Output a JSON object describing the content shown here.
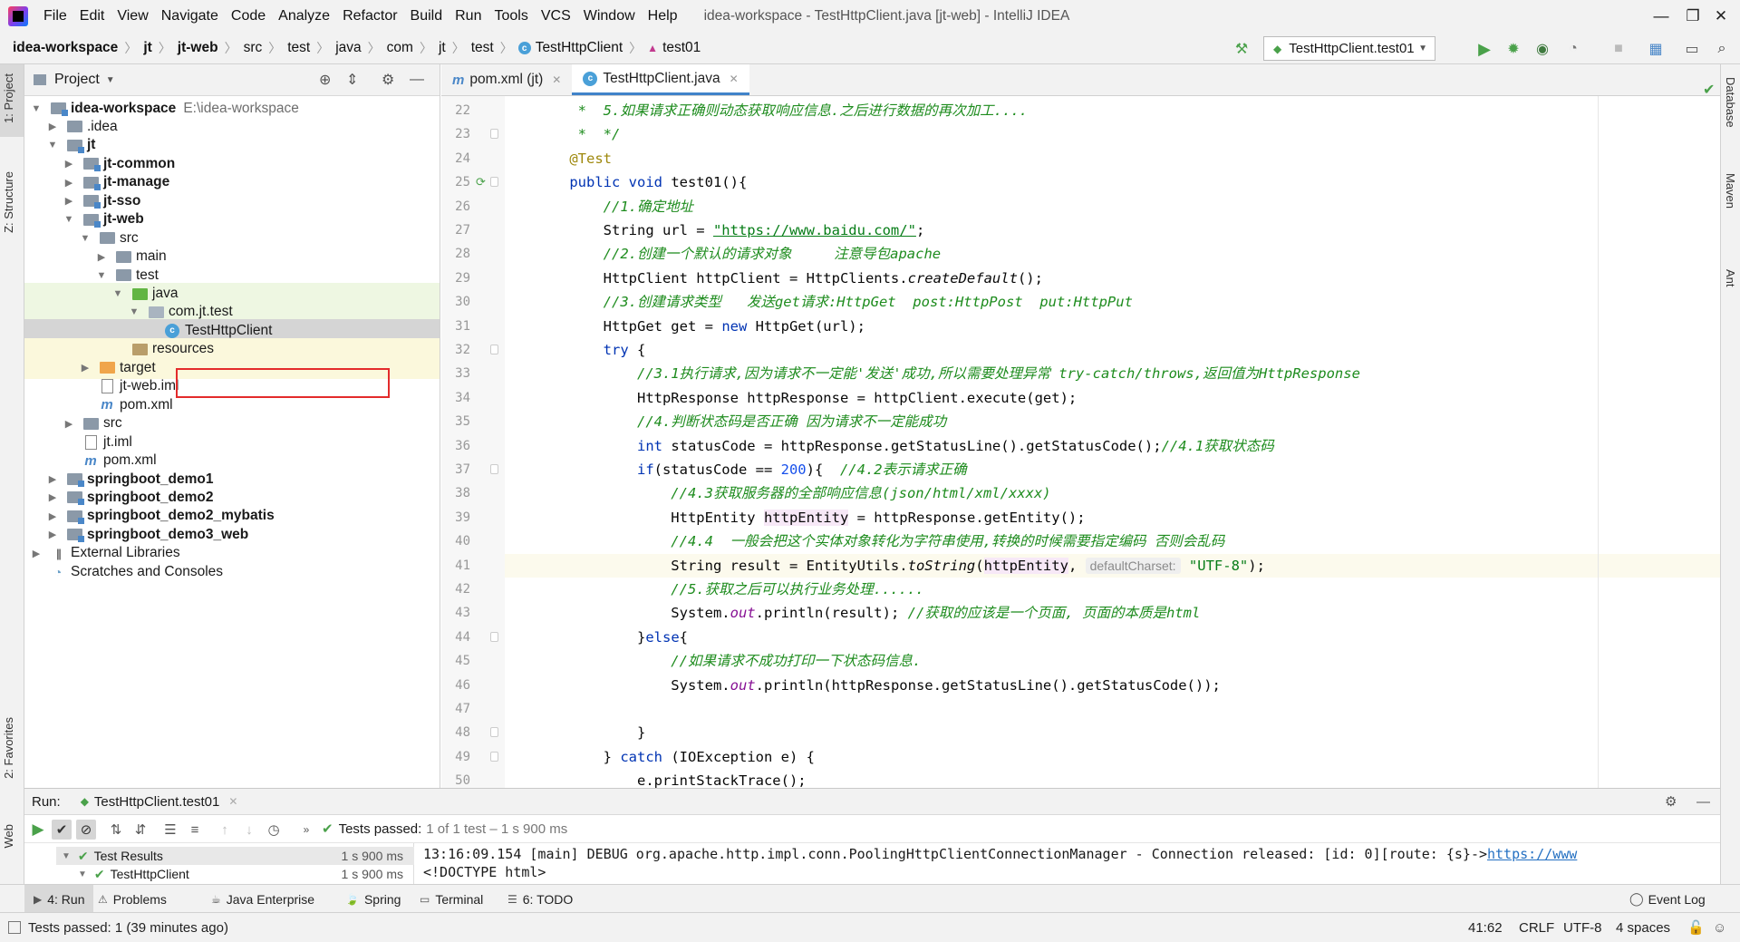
{
  "menubar": {
    "items": [
      "File",
      "Edit",
      "View",
      "Navigate",
      "Code",
      "Analyze",
      "Refactor",
      "Build",
      "Run",
      "Tools",
      "VCS",
      "Window",
      "Help"
    ],
    "window_title": "idea-workspace - TestHttpClient.java [jt-web] - IntelliJ IDEA",
    "controls": [
      "—",
      "❐",
      "✕"
    ]
  },
  "breadcrumbs": [
    "idea-workspace",
    "jt",
    "jt-web",
    "src",
    "test",
    "java",
    "com",
    "jt",
    "test",
    "TestHttpClient",
    "test01"
  ],
  "run_config": "TestHttpClient.test01",
  "left_stripe": {
    "project": "1: Project",
    "structure": "Z: Structure",
    "favorites": "2: Favorites",
    "web": "Web"
  },
  "right_stripe": {
    "database": "Database",
    "maven": "Maven",
    "ant": "Ant"
  },
  "project_panel": {
    "title": "Project",
    "tree": [
      {
        "label": "idea-workspace",
        "hint": "E:\\idea-workspace",
        "depth": 0,
        "arrow": "down",
        "icon": "module-folder",
        "bold": true
      },
      {
        "label": ".idea",
        "depth": 1,
        "arrow": "right",
        "icon": "folder"
      },
      {
        "label": "jt",
        "depth": 1,
        "arrow": "down",
        "icon": "module-folder",
        "bold": true
      },
      {
        "label": "jt-common",
        "depth": 2,
        "arrow": "right",
        "icon": "module-folder",
        "bold": true
      },
      {
        "label": "jt-manage",
        "depth": 2,
        "arrow": "right",
        "icon": "module-folder",
        "bold": true
      },
      {
        "label": "jt-sso",
        "depth": 2,
        "arrow": "right",
        "icon": "module-folder",
        "bold": true
      },
      {
        "label": "jt-web",
        "depth": 2,
        "arrow": "down",
        "icon": "module-folder",
        "bold": true
      },
      {
        "label": "src",
        "depth": 3,
        "arrow": "down",
        "icon": "folder"
      },
      {
        "label": "main",
        "depth": 4,
        "arrow": "right",
        "icon": "folder"
      },
      {
        "label": "test",
        "depth": 4,
        "arrow": "down",
        "icon": "folder"
      },
      {
        "label": "java",
        "depth": 5,
        "arrow": "down",
        "icon": "test-folder"
      },
      {
        "label": "com.jt.test",
        "depth": 6,
        "arrow": "down",
        "icon": "package"
      },
      {
        "label": "TestHttpClient",
        "depth": 7,
        "arrow": "",
        "icon": "class",
        "selected": true
      },
      {
        "label": "resources",
        "depth": 5,
        "arrow": "",
        "icon": "resources-folder"
      },
      {
        "label": "target",
        "depth": 3,
        "arrow": "right",
        "icon": "excluded-folder"
      },
      {
        "label": "jt-web.iml",
        "depth": 3,
        "arrow": "",
        "icon": "file"
      },
      {
        "label": "pom.xml",
        "depth": 3,
        "arrow": "",
        "icon": "maven"
      },
      {
        "label": "src",
        "depth": 2,
        "arrow": "right",
        "icon": "folder"
      },
      {
        "label": "jt.iml",
        "depth": 2,
        "arrow": "",
        "icon": "file"
      },
      {
        "label": "pom.xml",
        "depth": 2,
        "arrow": "",
        "icon": "maven"
      },
      {
        "label": "springboot_demo1",
        "depth": 1,
        "arrow": "right",
        "icon": "module-folder",
        "bold": true
      },
      {
        "label": "springboot_demo2",
        "depth": 1,
        "arrow": "right",
        "icon": "module-folder",
        "bold": true
      },
      {
        "label": "springboot_demo2_mybatis",
        "depth": 1,
        "arrow": "right",
        "icon": "module-folder",
        "bold": true
      },
      {
        "label": "springboot_demo3_web",
        "depth": 1,
        "arrow": "right",
        "icon": "module-folder",
        "bold": true
      },
      {
        "label": "External Libraries",
        "depth": 0,
        "arrow": "right",
        "icon": "libraries"
      },
      {
        "label": "Scratches and Consoles",
        "depth": 0,
        "arrow": "",
        "icon": "scratches"
      }
    ]
  },
  "editor": {
    "tabs": [
      {
        "label": "pom.xml (jt)",
        "icon": "m",
        "active": false
      },
      {
        "label": "TestHttpClient.java",
        "icon": "c",
        "active": true
      }
    ],
    "first_line": 22,
    "current_line": 41,
    "lines": [
      [
        [
          "cmg",
          "     *  5.如果请求正确则动态获取响应信息.之后进行数据的再次加工...."
        ]
      ],
      [
        [
          "cmg",
          "     *  */"
        ]
      ],
      [
        [
          "ann",
          "    @Test"
        ]
      ],
      [
        [
          "kw",
          "    public void "
        ],
        [
          "",
          "test01(){"
        ]
      ],
      [
        [
          "cmg",
          "        //1.确定地址"
        ]
      ],
      [
        [
          "",
          "        String url = "
        ],
        [
          "url",
          "\"https://www.baidu.com/\""
        ],
        [
          "",
          ";"
        ]
      ],
      [
        [
          "cmg",
          "        //2.创建一个默认的请求对象     注意导包apache"
        ]
      ],
      [
        [
          "",
          "        HttpClient httpClient = HttpClients."
        ],
        [
          "it",
          "createDefault"
        ],
        [
          "",
          "();"
        ]
      ],
      [
        [
          "cmg",
          "        //3.创建请求类型   发送get请求:HttpGet  post:HttpPost  put:HttpPut"
        ]
      ],
      [
        [
          "",
          "        HttpGet get = "
        ],
        [
          "kw",
          "new "
        ],
        [
          "",
          "HttpGet(url);"
        ]
      ],
      [
        [
          "kw",
          "        try "
        ],
        [
          "",
          "{"
        ]
      ],
      [
        [
          "cmg",
          "            //3.1执行请求,因为请求不一定能'发送'成功,所以需要处理异常 try-catch/throws,返回值为HttpResponse"
        ]
      ],
      [
        [
          "",
          "            HttpResponse httpResponse = httpClient.execute(get);"
        ]
      ],
      [
        [
          "cmg",
          "            //4.判断状态码是否正确 因为请求不一定能成功"
        ]
      ],
      [
        [
          "kw",
          "            int "
        ],
        [
          "",
          "statusCode = httpResponse.getStatusLine().getStatusCode();"
        ],
        [
          "cmg",
          "//4.1获取状态码"
        ]
      ],
      [
        [
          "kw",
          "            if"
        ],
        [
          "",
          "(statusCode == "
        ],
        [
          "num",
          "200"
        ],
        [
          "",
          "){  "
        ],
        [
          "cmg",
          "//4.2表示请求正确"
        ]
      ],
      [
        [
          "cmg",
          "                //4.3获取服务器的全部响应信息(json/html/xml/xxxx)"
        ]
      ],
      [
        [
          "",
          "                HttpEntity "
        ],
        [
          "hvar",
          "httpEntity"
        ],
        [
          "",
          " = httpResponse.getEntity();"
        ]
      ],
      [
        [
          "cmg",
          "                //4.4  一般会把这个实体对象转化为字符串使用,转换的时候需要指定编码 否则会乱码"
        ]
      ],
      [
        [
          "",
          "                String result = EntityUtils."
        ],
        [
          "it",
          "toString"
        ],
        [
          "",
          "("
        ],
        [
          "hvar",
          "httpEntity"
        ],
        [
          "",
          ", "
        ],
        [
          "hint",
          "defaultCharset:"
        ],
        [
          "",
          " "
        ],
        [
          "str",
          "\"UTF-8\""
        ],
        [
          "",
          ");"
        ]
      ],
      [
        [
          "cmg",
          "                //5.获取之后可以执行业务处理......"
        ]
      ],
      [
        [
          "",
          "                System."
        ],
        [
          "fld",
          "out"
        ],
        [
          "",
          ".println(result); "
        ],
        [
          "cmg",
          "//获取的应该是一个页面, 页面的本质是html"
        ]
      ],
      [
        [
          "",
          "            }"
        ],
        [
          "kw",
          "else"
        ],
        [
          "",
          "{"
        ]
      ],
      [
        [
          "cmg",
          "                //如果请求不成功打印一下状态码信息."
        ]
      ],
      [
        [
          "",
          "                System."
        ],
        [
          "fld",
          "out"
        ],
        [
          "",
          ".println(httpResponse.getStatusLine().getStatusCode());"
        ]
      ],
      [
        [
          "",
          ""
        ]
      ],
      [
        [
          "",
          "            }"
        ]
      ],
      [
        [
          "",
          "        } "
        ],
        [
          "kw",
          "catch "
        ],
        [
          "",
          "(IOException e) {"
        ]
      ],
      [
        [
          "",
          "            e.printStackTrace();"
        ]
      ]
    ]
  },
  "run_panel": {
    "label": "Run:",
    "tab": "TestHttpClient.test01",
    "tests_passed_label": "Tests passed:",
    "tests_passed_detail": "1 of 1 test – 1 s 900 ms",
    "tree": [
      {
        "label": "Test Results",
        "time": "1 s 900 ms"
      },
      {
        "label": "TestHttpClient",
        "time": "1 s 900 ms"
      }
    ],
    "console": [
      "13:16:09.154 [main] DEBUG org.apache.http.impl.conn.PoolingHttpClientConnectionManager - Connection released: [id: 0][route: {s}->",
      "<!DOCTYPE html>"
    ],
    "console_link": "https://www"
  },
  "tool_tabs": [
    {
      "label": "4: Run",
      "icon": "▶",
      "active": true
    },
    {
      "label": "Problems",
      "icon": "⚠"
    },
    {
      "label": "Java Enterprise",
      "icon": "☕"
    },
    {
      "label": "Spring",
      "icon": "🍃"
    },
    {
      "label": "Terminal",
      "icon": "▭"
    },
    {
      "label": "6: TODO",
      "icon": "☰"
    }
  ],
  "event_log": "Event Log",
  "status": {
    "message": "Tests passed: 1 (39 minutes ago)",
    "position": "41:62",
    "line_sep": "CRLF",
    "encoding": "UTF-8",
    "indent": "4 spaces"
  },
  "colors": {
    "accent": "#4083c9",
    "selection_box": "#e32b2b",
    "run_green": "#4aa14a"
  }
}
